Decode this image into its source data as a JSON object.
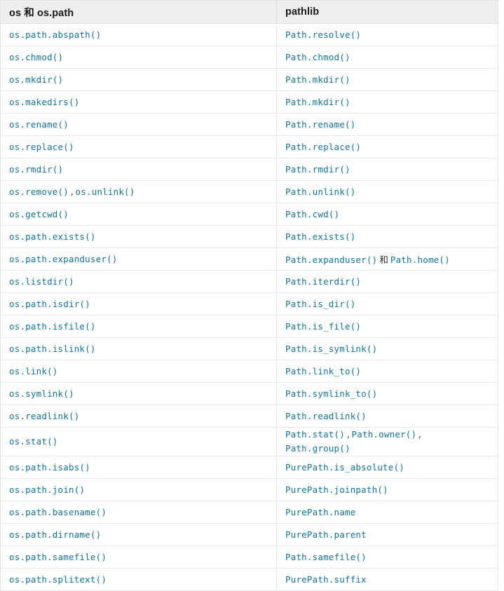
{
  "table": {
    "headers": [
      "os 和 os.path",
      "pathlib"
    ],
    "rows": [
      {
        "os": "os.path.abspath()",
        "pathlib": "Path.resolve()"
      },
      {
        "os": "os.chmod()",
        "pathlib": "Path.chmod()"
      },
      {
        "os": "os.mkdir()",
        "pathlib": "Path.mkdir()"
      },
      {
        "os": "os.makedirs()",
        "pathlib": "Path.mkdir()"
      },
      {
        "os": "os.rename()",
        "pathlib": "Path.rename()"
      },
      {
        "os": "os.replace()",
        "pathlib": "Path.replace()"
      },
      {
        "os": "os.rmdir()",
        "pathlib": "Path.rmdir()"
      },
      {
        "os": "os.remove()",
        "os_sep": ",",
        "os_extra": "os.unlink()",
        "pathlib": "Path.unlink()"
      },
      {
        "os": "os.getcwd()",
        "pathlib": "Path.cwd()"
      },
      {
        "os": "os.path.exists()",
        "pathlib": "Path.exists()"
      },
      {
        "os": "os.path.expanduser()",
        "pathlib": "Path.expanduser()",
        "pathlib_sep": "和",
        "pathlib_extra": "Path.home()"
      },
      {
        "os": "os.listdir()",
        "pathlib": "Path.iterdir()"
      },
      {
        "os": "os.path.isdir()",
        "pathlib": "Path.is_dir()"
      },
      {
        "os": "os.path.isfile()",
        "pathlib": "Path.is_file()"
      },
      {
        "os": "os.path.islink()",
        "pathlib": "Path.is_symlink()"
      },
      {
        "os": "os.link()",
        "pathlib": "Path.link_to()"
      },
      {
        "os": "os.symlink()",
        "pathlib": "Path.symlink_to()"
      },
      {
        "os": "os.readlink()",
        "pathlib": "Path.readlink()"
      },
      {
        "os": "os.stat()",
        "pathlib": "Path.stat()",
        "pathlib_sep": ",",
        "pathlib_extra": "Path.owner()",
        "pathlib_sep2": ",",
        "pathlib_extra2": "Path.group()",
        "wraps": true
      },
      {
        "os": "os.path.isabs()",
        "pathlib": "PurePath.is_absolute()"
      },
      {
        "os": "os.path.join()",
        "pathlib": "PurePath.joinpath()"
      },
      {
        "os": "os.path.basename()",
        "pathlib": "PurePath.name"
      },
      {
        "os": "os.path.dirname()",
        "pathlib": "PurePath.parent"
      },
      {
        "os": "os.path.samefile()",
        "pathlib": "Path.samefile()"
      },
      {
        "os": "os.path.splitext()",
        "pathlib": "PurePath.suffix"
      }
    ]
  },
  "colors": {
    "code_text": "#15729a",
    "header_bg": "#eeeeee",
    "header_text": "#1a1a1a",
    "border": "#e8e8e8",
    "separator_text": "#7a5a5a"
  }
}
